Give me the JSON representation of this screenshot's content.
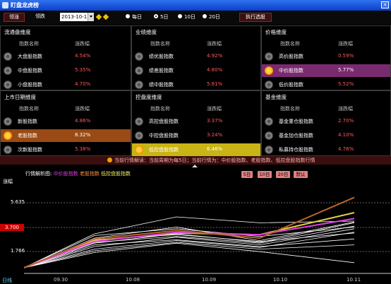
{
  "window": {
    "title": "盯盘龙虎榜"
  },
  "toolbar": {
    "btn1": "领涨",
    "btn2": "领跌",
    "date_value": "2013-10-11",
    "period_options": [
      "每日",
      "5日",
      "10日",
      "20日"
    ],
    "selected_period": "5日",
    "execute_label": "执行选股"
  },
  "panels": [
    {
      "title": "流通盘维度",
      "col_name": "指数名称",
      "col_pct": "涨跌幅",
      "rows": [
        {
          "name": "大盘股指数",
          "pct": "4.54%"
        },
        {
          "name": "中盘股指数",
          "pct": "5.35%"
        },
        {
          "name": "小盘股指数",
          "pct": "4.70%"
        }
      ]
    },
    {
      "title": "业绩维度",
      "col_name": "指数名称",
      "col_pct": "涨跌幅",
      "rows": [
        {
          "name": "绩优股指数",
          "pct": "4.92%"
        },
        {
          "name": "绩差股指数",
          "pct": "4.80%"
        },
        {
          "name": "绩中股指数",
          "pct": "5.81%"
        }
      ]
    },
    {
      "title": "价格维度",
      "col_name": "指数名称",
      "col_pct": "涨跌幅",
      "rows": [
        {
          "name": "高价股指数",
          "pct": "0.59%"
        },
        {
          "name": "中价股指数",
          "pct": "5.77%"
        },
        {
          "name": "低价股指数",
          "pct": "5.52%"
        }
      ]
    },
    {
      "title": "上市日期维度",
      "col_name": "指数名称",
      "col_pct": "涨跌幅",
      "rows": [
        {
          "name": "新股指数",
          "pct": "4.86%"
        },
        {
          "name": "老股指数",
          "pct": "8.32%"
        },
        {
          "name": "次新股指数",
          "pct": "5.38%"
        }
      ]
    },
    {
      "title": "控盘度维度",
      "col_name": "指数名称",
      "col_pct": "涨跌幅",
      "rows": [
        {
          "name": "高控盘股指数",
          "pct": "3.37%"
        },
        {
          "name": "中控盘股指数",
          "pct": "3.24%"
        },
        {
          "name": "低控盘股指数",
          "pct": "6.46%"
        }
      ]
    },
    {
      "title": "基金维度",
      "col_name": "指数名称",
      "col_pct": "涨跌幅",
      "rows": [
        {
          "name": "基金重仓股指数",
          "pct": "2.70%"
        },
        {
          "name": "基金加仓股指数",
          "pct": "4.10%"
        },
        {
          "name": "私募持仓股指数",
          "pct": "4.76%"
        }
      ]
    }
  ],
  "info_bar": {
    "text": "当前行情解读：当前周期为每5日；当前行情为：中价股指数、老股指数、低控盘股指数行情"
  },
  "chart_header": {
    "label": "行情解析图:",
    "s1": "中价股指数",
    "s2": "老股指数",
    "s3": "低控盘股指数",
    "range_buttons": [
      "5日",
      "10日",
      "20日",
      "默认"
    ]
  },
  "chart_data": {
    "type": "line",
    "ylabel": "涨幅",
    "x": [
      "09.30",
      "10.08",
      "10.09",
      "10.10",
      "10.11"
    ],
    "y_ticks": [
      "5.635",
      "3.700",
      "1.766"
    ],
    "highlight_y": "3.700",
    "series": [
      {
        "name": "老股指数",
        "color": "#b8652a",
        "values": [
          0,
          3.4,
          4.4,
          3.5,
          8.3
        ]
      },
      {
        "name": "中价股指数",
        "color": "#e040e0",
        "values": [
          0,
          3.1,
          4.2,
          3.9,
          5.8
        ]
      },
      {
        "name": "低控盘股指数",
        "color": "#e0d040",
        "values": [
          0,
          3.2,
          4.1,
          3.9,
          6.5
        ]
      },
      {
        "color": "#ffffff",
        "values": [
          0,
          2.5,
          3.6,
          2.7,
          4.6
        ]
      },
      {
        "color": "#ffffff",
        "values": [
          0,
          2.9,
          4.0,
          3.0,
          5.3
        ]
      },
      {
        "color": "#ffffff",
        "values": [
          0,
          3.5,
          4.8,
          3.2,
          5.4
        ]
      },
      {
        "color": "#ffffff",
        "values": [
          0,
          2.2,
          3.2,
          2.4,
          4.2
        ]
      },
      {
        "color": "#ffffff",
        "values": [
          0,
          3.0,
          3.7,
          2.9,
          4.9
        ]
      },
      {
        "color": "#ffffff",
        "values": [
          0,
          1.8,
          2.9,
          1.9,
          0.6
        ]
      },
      {
        "color": "#ffffff",
        "values": [
          0,
          3.8,
          4.6,
          3.7,
          4.8
        ]
      },
      {
        "color": "#ffffff",
        "values": [
          0,
          2.7,
          3.3,
          2.5,
          3.4
        ]
      },
      {
        "color": "#ffffff",
        "values": [
          0,
          4.0,
          6.0,
          5.3,
          5.5
        ]
      },
      {
        "color": "#ffffff",
        "values": [
          0,
          2.0,
          3.0,
          2.2,
          2.7
        ]
      },
      {
        "color": "#ffffff",
        "values": [
          0,
          3.3,
          3.9,
          3.1,
          4.1
        ]
      }
    ]
  },
  "footer": {
    "label": "日线"
  }
}
